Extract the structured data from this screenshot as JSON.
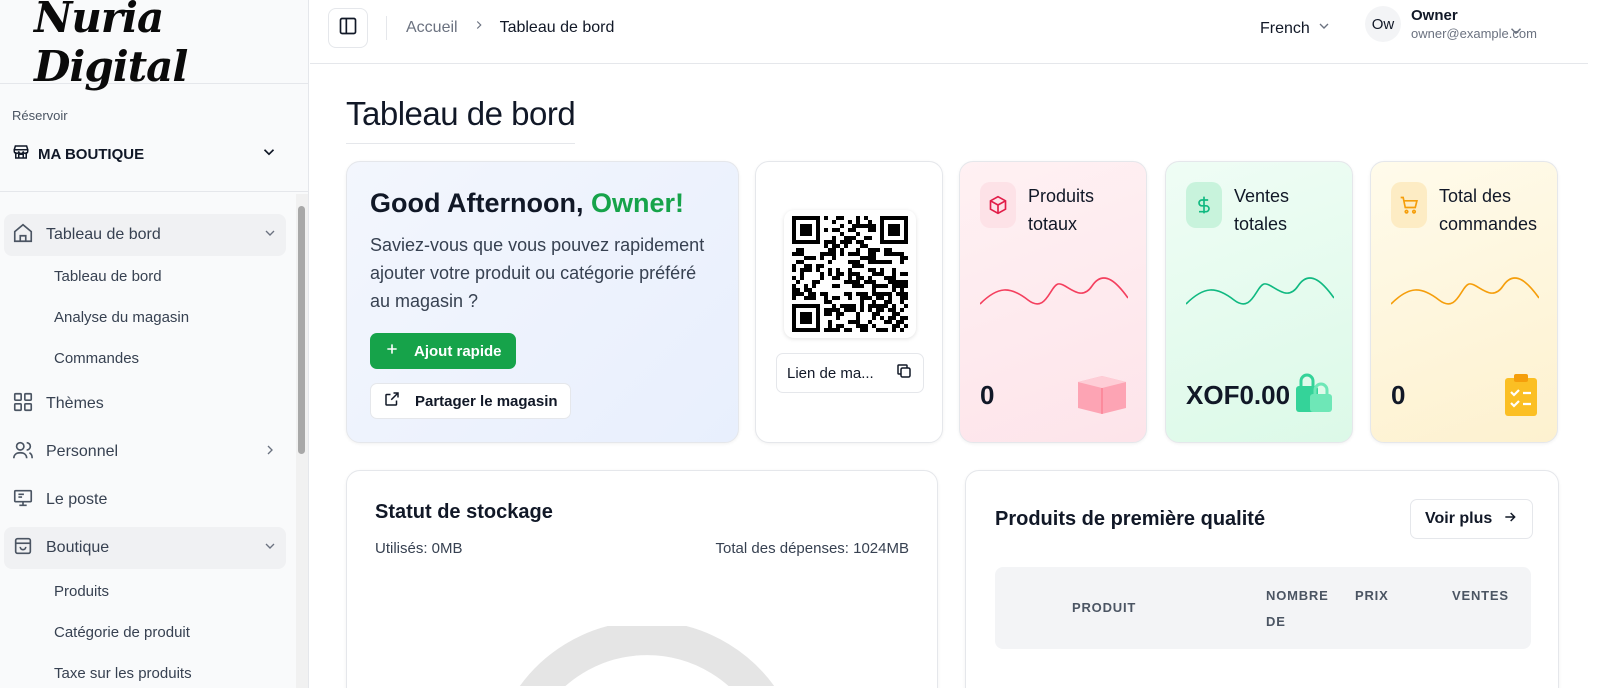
{
  "sidebar": {
    "logo_text": "Nuria Digital",
    "store_caption": "Réservoir",
    "store_name": "MA BOUTIQUE",
    "items": [
      {
        "label": "Tableau de bord"
      },
      {
        "label": "Thèmes"
      },
      {
        "label": "Personnel"
      },
      {
        "label": "Le poste"
      },
      {
        "label": "Boutique"
      }
    ],
    "dashboard_sub": [
      "Tableau de bord",
      "Analyse du magasin",
      "Commandes"
    ],
    "shop_sub": [
      "Produits",
      "Catégorie de produit",
      "Taxe sur les produits"
    ]
  },
  "topbar": {
    "breadcrumb_home": "Accueil",
    "breadcrumb_current": "Tableau de bord",
    "language": "French",
    "user": {
      "initials": "Ow",
      "name": "Owner",
      "email": "owner@example.com"
    }
  },
  "main": {
    "title": "Tableau de bord",
    "welcome": {
      "greeting": "Good Afternoon,",
      "name": "Owner!",
      "text": "Saviez-vous que vous pouvez rapidement ajouter votre produit ou catégorie préféré au magasin ?",
      "quick_add_label": "Ajout rapide",
      "share_label": "Partager le magasin"
    },
    "qr": {
      "link_label": "Lien de ma..."
    },
    "stats": [
      {
        "label": "Produits totaux",
        "value": "0",
        "icon": "cube-icon",
        "color": "#e11d48"
      },
      {
        "label": "Ventes totales",
        "value": "XOF0.00",
        "icon": "dollar-icon",
        "color": "#10b981"
      },
      {
        "label": "Total des commandes",
        "value": "0",
        "icon": "cart-icon",
        "color": "#f59e0b"
      }
    ],
    "storage": {
      "title": "Statut de stockage",
      "used": "Utilisés: 0MB",
      "total": "Total des dépenses: 1024MB"
    },
    "products": {
      "title": "Produits de première qualité",
      "more_label": "Voir plus",
      "columns": [
        "PRODUIT",
        "NOMBRE DE",
        "PRIX",
        "VENTES"
      ]
    }
  },
  "colors": {
    "accent": "#16a34a"
  }
}
